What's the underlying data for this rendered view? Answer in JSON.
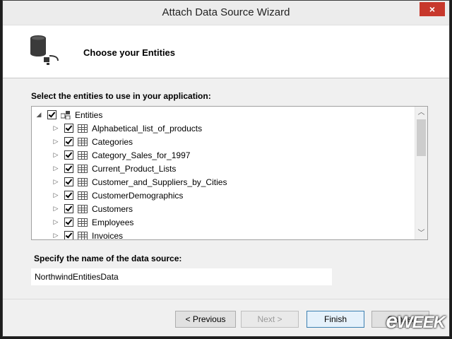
{
  "window": {
    "title": "Attach Data Source Wizard",
    "close_label": "×"
  },
  "header": {
    "title": "Choose your Entities"
  },
  "entities": {
    "label": "Select the entities to use in your application:",
    "root": {
      "label": "Entities",
      "checked": true
    },
    "items": [
      "Alphabetical_list_of_products",
      "Categories",
      "Category_Sales_for_1997",
      "Current_Product_Lists",
      "Customer_and_Suppliers_by_Cities",
      "CustomerDemographics",
      "Customers",
      "Employees",
      "Invoices"
    ]
  },
  "datasource": {
    "label": "Specify the name of the data source:",
    "value": "NorthwindEntitiesData"
  },
  "buttons": {
    "previous": "< Previous",
    "next": "Next >",
    "finish": "Finish",
    "cancel": "Cancel"
  },
  "watermark": {
    "prefix": "e",
    "text": "WEEK"
  },
  "colors": {
    "close": "#c7382c",
    "accent": "#3c7fb1"
  }
}
